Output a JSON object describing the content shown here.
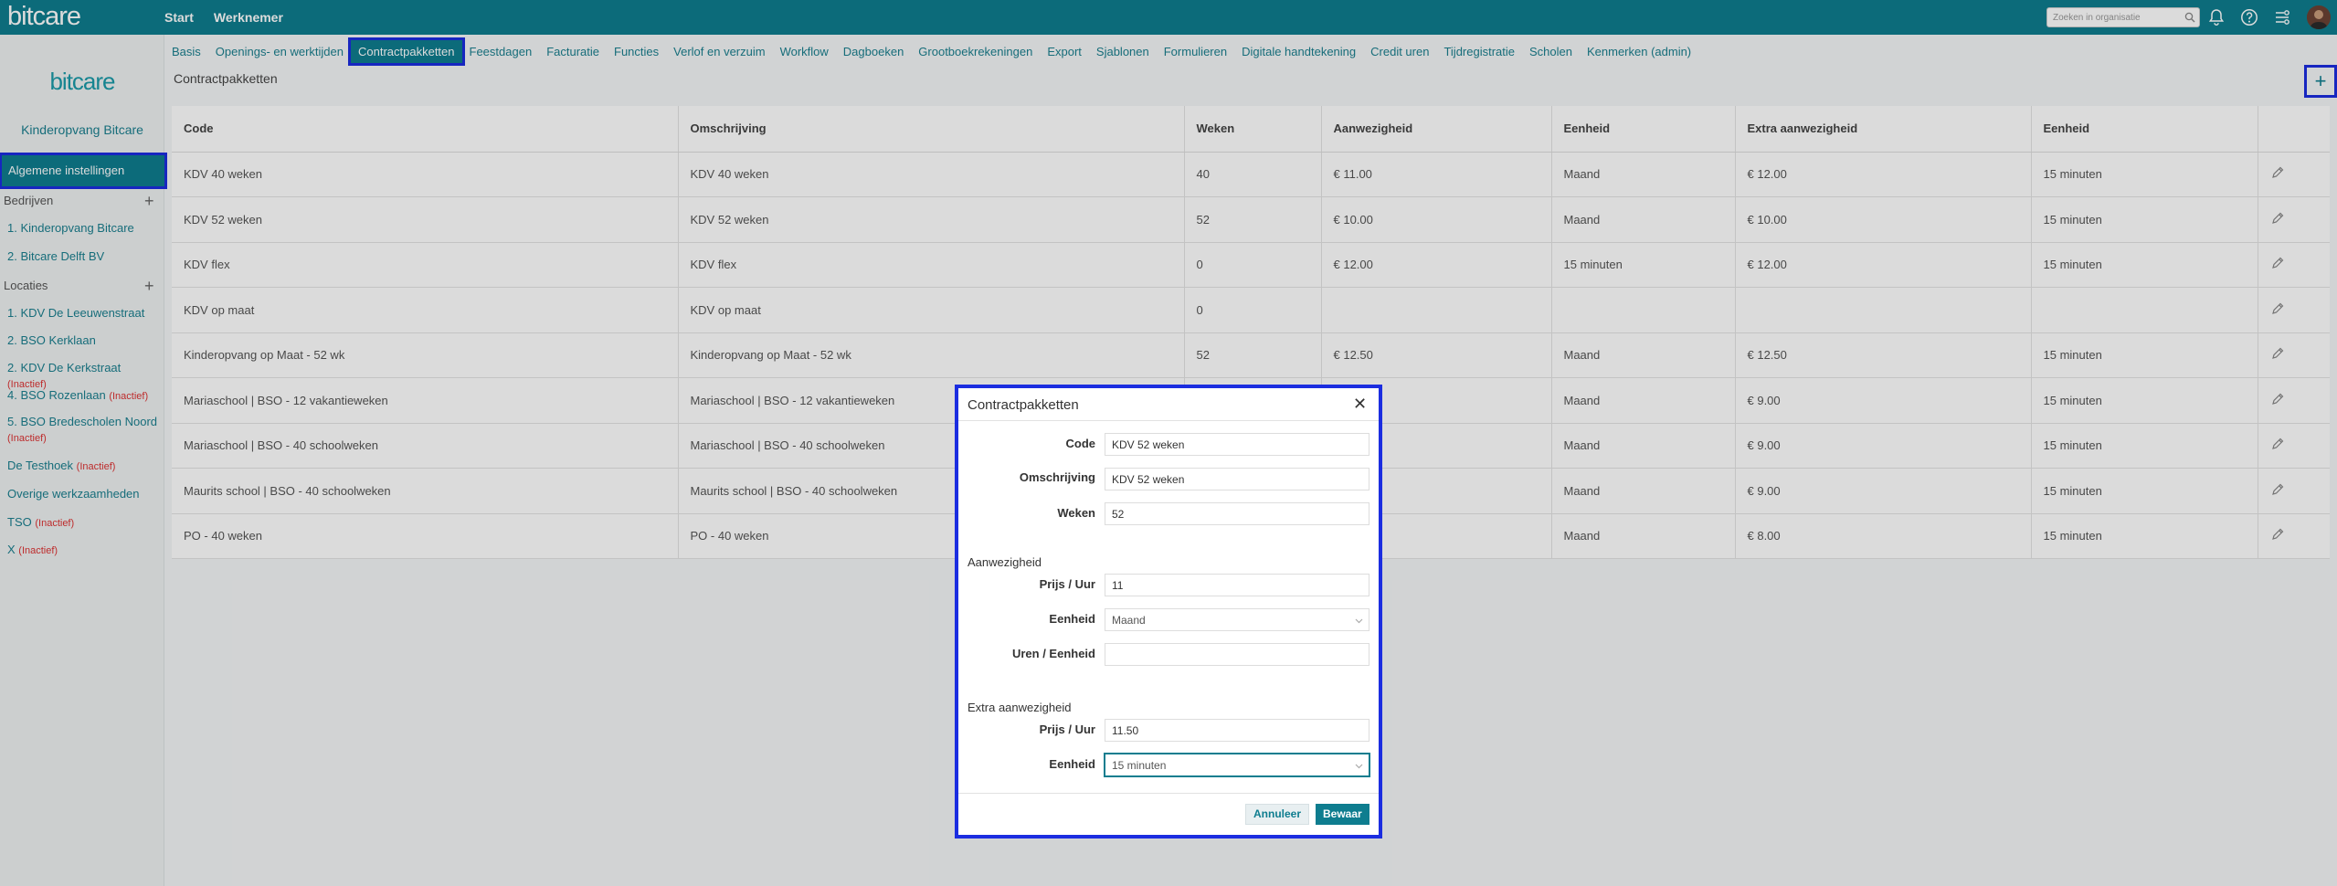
{
  "app": {
    "logo": "bitcare"
  },
  "topnav": {
    "items": [
      "Start",
      "Werknemer"
    ]
  },
  "search": {
    "placeholder": "Zoeken in organisatie"
  },
  "subnav": {
    "items": [
      "Basis",
      "Openings- en werktijden",
      "Contractpakketten",
      "Feestdagen",
      "Facturatie",
      "Functies",
      "Verlof en verzuim",
      "Workflow",
      "Dagboeken",
      "Grootboekrekeningen",
      "Export",
      "Sjablonen",
      "Formulieren",
      "Digitale handtekening",
      "Credit uren",
      "Tijdregistratie",
      "Scholen",
      "Kenmerken (admin)"
    ],
    "active_index": 2
  },
  "sidebar": {
    "logo": "bitcare",
    "company": "Kinderopvang Bitcare",
    "general": "Algemene instellingen",
    "companies_title": "Bedrijven",
    "companies": [
      "1. Kinderopvang Bitcare",
      "2. Bitcare Delft BV"
    ],
    "locations_title": "Locaties",
    "inactive_label": "(Inactief)",
    "locations": [
      {
        "name": "1. KDV De Leeuwenstraat",
        "inactive": ""
      },
      {
        "name": "2. BSO Kerklaan",
        "inactive": ""
      },
      {
        "name": "2. KDV De Kerkstraat",
        "inactive": "(Inactief)"
      },
      {
        "name": "4. BSO Rozenlaan",
        "inactive": "(Inactief)"
      },
      {
        "name": "5. BSO Bredescholen Noord",
        "inactive": "(Inactief)"
      },
      {
        "name": "De Testhoek",
        "inactive": "(Inactief)"
      },
      {
        "name": "Overige werkzaamheden",
        "inactive": ""
      },
      {
        "name": "TSO",
        "inactive": "(Inactief)"
      },
      {
        "name": "X",
        "inactive": "(Inactief)"
      }
    ]
  },
  "page": {
    "title": "Contractpakketten"
  },
  "table": {
    "columns": [
      "Code",
      "Omschrijving",
      "Weken",
      "Aanwezigheid",
      "Eenheid",
      "Extra aanwezigheid",
      "Eenheid",
      ""
    ],
    "rows": [
      [
        "KDV 40 weken",
        "KDV 40 weken",
        "40",
        "€ 11.00",
        "Maand",
        "€ 12.00",
        "15 minuten"
      ],
      [
        "KDV 52 weken",
        "KDV 52 weken",
        "52",
        "€ 10.00",
        "Maand",
        "€ 10.00",
        "15 minuten"
      ],
      [
        "KDV flex",
        "KDV flex",
        "0",
        "€ 12.00",
        "15 minuten",
        "€ 12.00",
        "15 minuten"
      ],
      [
        "KDV op maat",
        "KDV op maat",
        "0",
        "",
        "",
        "",
        ""
      ],
      [
        "Kinderopvang op Maat - 52 wk",
        "Kinderopvang op Maat - 52 wk",
        "52",
        "€ 12.50",
        "Maand",
        "€ 12.50",
        "15 minuten"
      ],
      [
        "Mariaschool | BSO - 12 vakantieweken",
        "Mariaschool | BSO - 12 vakantieweken",
        "",
        "",
        "Maand",
        "€ 9.00",
        "15 minuten"
      ],
      [
        "Mariaschool | BSO - 40 schoolweken",
        "Mariaschool | BSO - 40 schoolweken",
        "",
        "",
        "Maand",
        "€ 9.00",
        "15 minuten"
      ],
      [
        "Maurits school | BSO - 40 schoolweken",
        "Maurits school | BSO - 40 schoolweken",
        "",
        "",
        "Maand",
        "€ 9.00",
        "15 minuten"
      ],
      [
        "PO - 40 weken",
        "PO - 40 weken",
        "",
        "",
        "Maand",
        "€ 8.00",
        "15 minuten"
      ]
    ]
  },
  "modal": {
    "title": "Contractpakketten",
    "code_label": "Code",
    "code_value": "KDV 52 weken",
    "omschrijving_label": "Omschrijving",
    "omschrijving_value": "KDV 52 weken",
    "weken_label": "Weken",
    "weken_value": "52",
    "aanwezigheid_title": "Aanwezigheid",
    "prijs_label": "Prijs / Uur",
    "prijs_value": "11",
    "eenheid_label": "Eenheid",
    "eenheid_value": "Maand",
    "uren_label": "Uren / Eenheid",
    "uren_value": "",
    "extra_title": "Extra aanwezigheid",
    "extra_prijs_label": "Prijs / Uur",
    "extra_prijs_value": "11.50",
    "extra_eenheid_label": "Eenheid",
    "extra_eenheid_value": "15 minuten",
    "cancel_label": "Annuleer",
    "save_label": "Bewaar"
  },
  "colors": {
    "primary": "#0e7d8f",
    "highlight": "#1b2de0",
    "inactive": "#dd3333"
  }
}
